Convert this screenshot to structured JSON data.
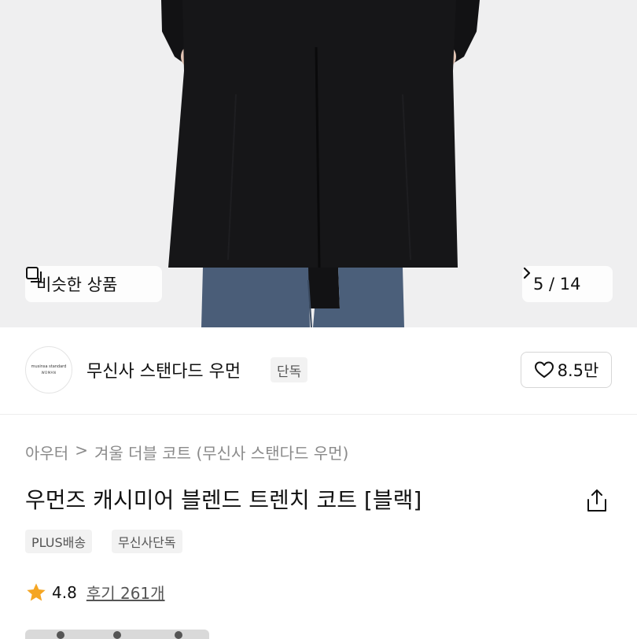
{
  "gallery": {
    "similar_label": "비슷한 상품",
    "pager": {
      "current": "5",
      "separator": "/",
      "total": "14",
      "text": "5 / 14"
    },
    "icons": {
      "similar": "stacked-squares-icon",
      "next": "chevron-right-icon"
    }
  },
  "brand": {
    "logo_line1": "musinsa standard",
    "logo_line2": "WOMAN",
    "name": "무신사 스탠다드 우먼",
    "badge": "단독",
    "likes": "8.5만",
    "like_icon": "heart-outline-icon"
  },
  "product": {
    "breadcrumb": [
      "아우터",
      "겨울 더블 코트 (무신사 스탠다드 우먼)"
    ],
    "breadcrumb_separator": ">",
    "title": "우먼즈 캐시미어 블렌드 트렌치 코트 [블랙]",
    "share_icon": "share-icon",
    "tags": [
      "PLUS배송",
      "무신사단독"
    ],
    "rating": "4.8",
    "rating_icon": "star-icon",
    "review_link": "후기 261개"
  },
  "colors": {
    "star": "#f5a623",
    "text_primary": "#111111",
    "text_muted": "#8a8a8a",
    "tag_bg": "#f2f2f2"
  }
}
